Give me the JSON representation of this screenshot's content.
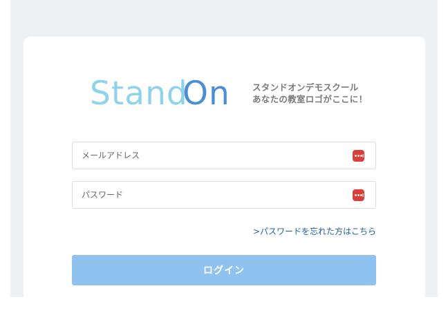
{
  "logo": {
    "word_part1": "Stand",
    "word_part2": "On",
    "tagline_line1": "スタンドオンデモスクール",
    "tagline_line2": "あなたの教室ロゴがここに！"
  },
  "form": {
    "email_placeholder": "メールアドレス",
    "email_value": "",
    "password_placeholder": "パスワード",
    "password_value": "",
    "forgot_link": ">パスワードを忘れた方はこちら",
    "login_button": "ログイン"
  },
  "icons": {
    "password_manager": "password-manager-icon"
  },
  "colors": {
    "page_bg": "#eef1f4",
    "card_bg": "#ffffff",
    "logo_light_blue": "#8fd3ea",
    "logo_dark_blue": "#4a8fd6",
    "button_bg": "#8fc2ef",
    "link": "#1f5fa3",
    "password_badge": "#d9403a"
  }
}
